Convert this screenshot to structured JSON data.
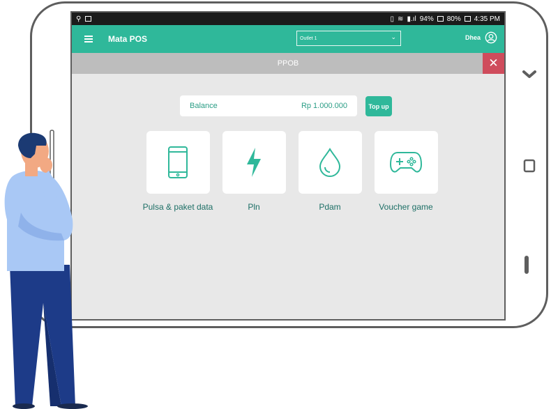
{
  "status_bar": {
    "left_icons": [
      "usb-icon",
      "photo-icon"
    ],
    "battery_percent_1": "94%",
    "battery_percent_2": "80%",
    "time": "4:35 PM"
  },
  "app_bar": {
    "menu_icon": "hamburger-icon",
    "title": "Mata POS",
    "outlet": "Outlet 1",
    "user_name": "Dhea",
    "avatar_icon": "user-circle-icon"
  },
  "page": {
    "title": "PPOB",
    "close_label": "✕"
  },
  "balance": {
    "label": "Balance",
    "amount": "Rp 1.000.000",
    "topup_label": "Top up"
  },
  "services": [
    {
      "label": "Pulsa & paket data",
      "icon": "smartphone-icon"
    },
    {
      "label": "Pln",
      "icon": "lightning-icon"
    },
    {
      "label": "Pdam",
      "icon": "water-drop-icon"
    },
    {
      "label": "Voucher game",
      "icon": "gamepad-icon"
    }
  ],
  "colors": {
    "primary": "#2fb89a",
    "danger": "#cf4c5c",
    "text_teal": "#1d6f66",
    "background": "#e8e8e8"
  }
}
